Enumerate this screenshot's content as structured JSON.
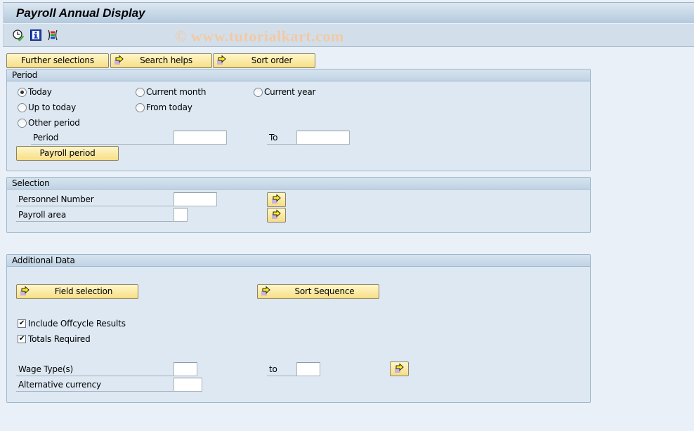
{
  "window": {
    "title": "Payroll Annual Display",
    "watermark": "© www.tutorialkart.com"
  },
  "toolbar": {
    "icons": [
      "execute-clock-icon",
      "info-icon",
      "selection-options-icon"
    ]
  },
  "top_buttons": {
    "further_selections": "Further selections",
    "search_helps": "Search helps",
    "sort_order": "Sort order"
  },
  "period": {
    "title": "Period",
    "options": {
      "today": "Today",
      "current_month": "Current month",
      "current_year": "Current year",
      "up_to_today": "Up to today",
      "from_today": "From today",
      "other_period": "Other period"
    },
    "selected": "today",
    "period_label": "Period",
    "period_from_value": "",
    "to_label": "To",
    "period_to_value": "",
    "payroll_period_button": "Payroll period"
  },
  "selection": {
    "title": "Selection",
    "personnel_number_label": "Personnel Number",
    "personnel_number_value": "",
    "payroll_area_label": "Payroll area",
    "payroll_area_value": ""
  },
  "additional_data": {
    "title": "Additional Data",
    "field_selection_button": "Field selection",
    "sort_sequence_button": "Sort Sequence",
    "include_offcycle_label": "Include Offcycle Results",
    "include_offcycle_checked": true,
    "totals_required_label": "Totals Required",
    "totals_required_checked": true,
    "wage_types_label": "Wage Type(s)",
    "wage_types_from_value": "",
    "wage_types_to_label": "to",
    "wage_types_to_value": "",
    "alt_currency_label": "Alternative currency",
    "alt_currency_value": "",
    "check_mark": "✔"
  }
}
